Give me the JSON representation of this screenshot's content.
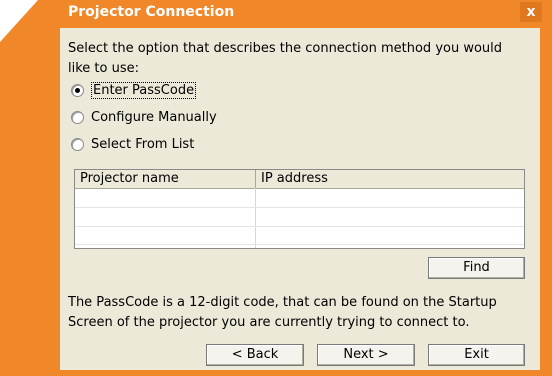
{
  "window": {
    "title": "Projector Connection",
    "close_glyph": "x"
  },
  "prompt": "Select the option that describes the connection method you would like to use:",
  "options": [
    {
      "label": "Enter PassCode",
      "checked": true
    },
    {
      "label": "Configure Manually",
      "checked": false
    },
    {
      "label": "Select From List",
      "checked": false
    }
  ],
  "list": {
    "columns": [
      "Projector name",
      "IP address"
    ],
    "rows": []
  },
  "buttons": {
    "find": "Find",
    "back": "< Back",
    "next": "Next >",
    "exit": "Exit"
  },
  "info": "The PassCode is a 12-digit code, that can be found on the Startup Screen of the projector you are currently trying to connect to.",
  "colors": {
    "accent": "#f0882a",
    "dialog_bg": "#ece9d8"
  },
  "icons": [
    "close-icon",
    "radio-icon"
  ]
}
